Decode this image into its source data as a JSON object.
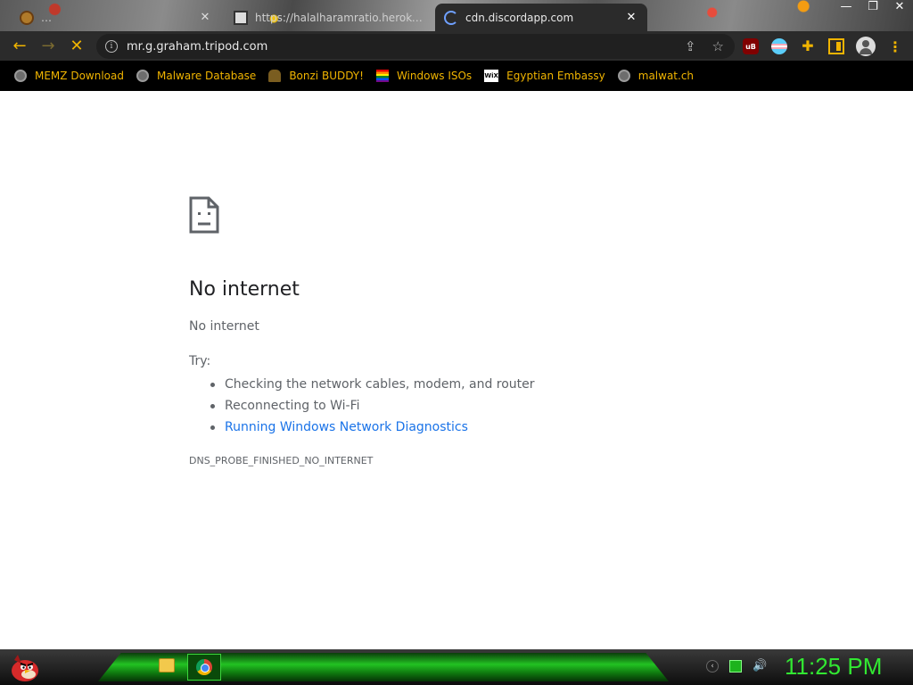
{
  "tabs": [
    {
      "title": "…",
      "favicon": "round-avatar-icon",
      "active": false
    },
    {
      "title": "https://halalharamratio.heroku...",
      "favicon": "calculator-icon",
      "active": false
    },
    {
      "title": "cdn.discordapp.com",
      "favicon": "loading-spinner-icon",
      "active": true
    }
  ],
  "window_controls": {
    "minimize": "—",
    "restore": "❐",
    "close": "✕"
  },
  "toolbar": {
    "back": "←",
    "forward": "→",
    "stop": "✕",
    "info": "i",
    "url": "mr.g.graham.tripod.com",
    "share": "⇪",
    "bookmark_star": "☆",
    "ublock_label": "uB",
    "puzzle": "✚",
    "menu": "⋮"
  },
  "bookmarks": [
    {
      "label": "MEMZ Download",
      "icon": "globe-icon"
    },
    {
      "label": "Malware Database",
      "icon": "globe-icon"
    },
    {
      "label": "Bonzi BUDDY!",
      "icon": "bonzi-icon"
    },
    {
      "label": "Windows ISOs",
      "icon": "rainbow-flag-icon"
    },
    {
      "label": "Egyptian Embassy",
      "icon": "wix-icon",
      "icon_text": "WiX"
    },
    {
      "label": "malwat.ch",
      "icon": "globe-icon"
    }
  ],
  "error_page": {
    "heading": "No internet",
    "subheading": "No internet",
    "try_label": "Try:",
    "suggestions": [
      "Checking the network cables, modem, and router",
      "Reconnecting to Wi-Fi",
      "Running Windows Network Diagnostics"
    ],
    "error_code": "DNS_PROBE_FINISHED_NO_INTERNET"
  },
  "taskbar": {
    "clock": "11:25 PM",
    "tray_chevron": "‹",
    "volume": "🔊"
  },
  "colors": {
    "accent": "#f0b400",
    "link": "#1a73e8",
    "clock": "#32e832",
    "taskbar_glow": "#22c222"
  }
}
